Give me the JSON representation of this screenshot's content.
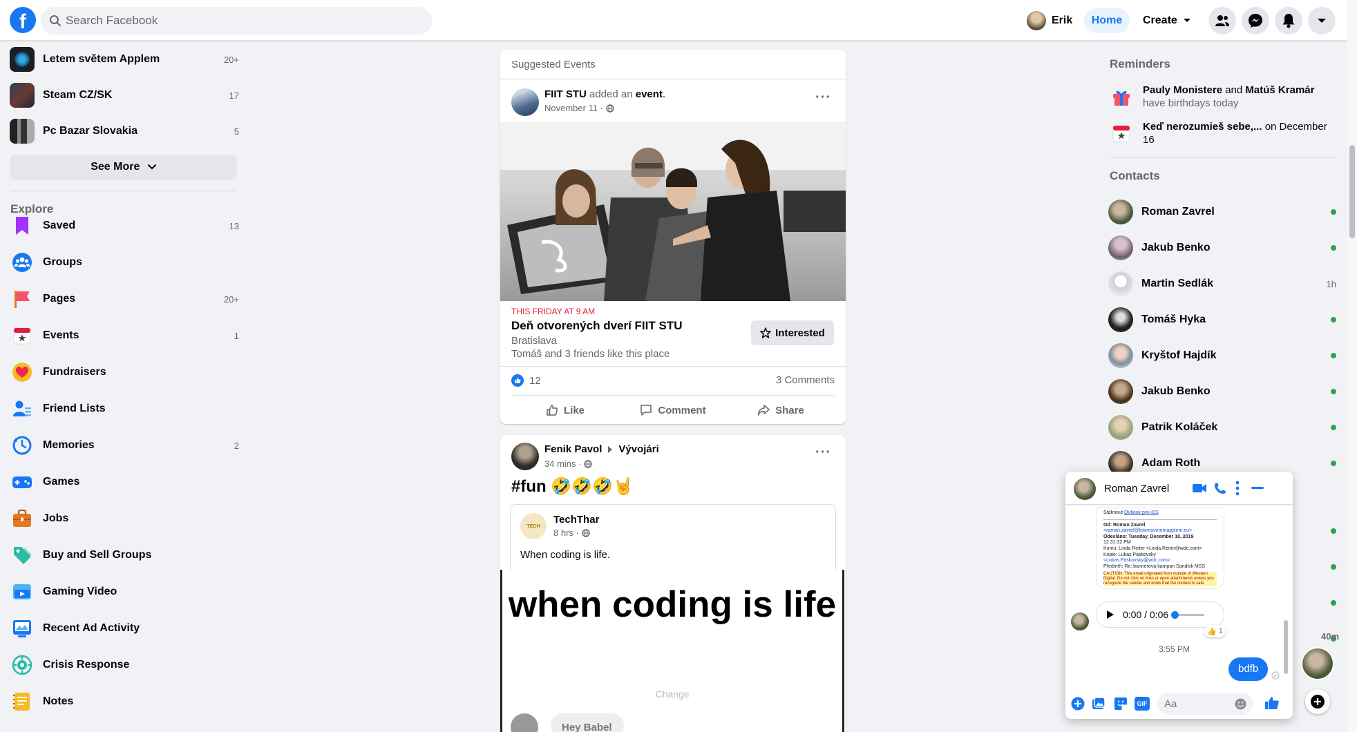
{
  "header": {
    "logo": "f",
    "search_placeholder": "Search Facebook",
    "profile_name": "Erik",
    "home_label": "Home",
    "create_label": "Create",
    "icons": [
      "people-icon",
      "messenger-icon",
      "bell-icon",
      "caret-down-icon"
    ]
  },
  "sidebar": {
    "groups": [
      {
        "name": "Letem světem Applem",
        "count": "20+"
      },
      {
        "name": "Steam CZ/SK",
        "count": "17"
      },
      {
        "name": "Pc Bazar Slovakia",
        "count": "5"
      }
    ],
    "see_more": "See More",
    "explore_title": "Explore",
    "explore": [
      {
        "label": "Saved",
        "count": "13",
        "icon": "bookmark-icon",
        "color": "#a033ff"
      },
      {
        "label": "Groups",
        "count": "",
        "icon": "groups-icon",
        "color": "#1877f2"
      },
      {
        "label": "Pages",
        "count": "20+",
        "icon": "flag-icon",
        "color": "#f35369"
      },
      {
        "label": "Events",
        "count": "1",
        "icon": "calendar-icon",
        "color": "#e41e3f"
      },
      {
        "label": "Fundraisers",
        "count": "",
        "icon": "heart-icon",
        "color": "#f7b928"
      },
      {
        "label": "Friend Lists",
        "count": "",
        "icon": "friend-list-icon",
        "color": "#1877f2"
      },
      {
        "label": "Memories",
        "count": "2",
        "icon": "clock-icon",
        "color": "#1877f2"
      },
      {
        "label": "Games",
        "count": "",
        "icon": "gamepad-icon",
        "color": "#1877f2"
      },
      {
        "label": "Jobs",
        "count": "",
        "icon": "briefcase-icon",
        "color": "#e77623"
      },
      {
        "label": "Buy and Sell Groups",
        "count": "",
        "icon": "tag-icon",
        "color": "#2abba7"
      },
      {
        "label": "Gaming Video",
        "count": "",
        "icon": "video-icon",
        "color": "#1877f2"
      },
      {
        "label": "Recent Ad Activity",
        "count": "",
        "icon": "ad-icon",
        "color": "#1877f2"
      },
      {
        "label": "Crisis Response",
        "count": "",
        "icon": "crisis-icon",
        "color": "#2abba7"
      },
      {
        "label": "Notes",
        "count": "",
        "icon": "notes-icon",
        "color": "#f7b928"
      }
    ]
  },
  "feed": {
    "suggested_title": "Suggested Events",
    "event_post": {
      "author": "FIIT STU",
      "action_pre": "added an",
      "action_obj": "event",
      "action_post": ".",
      "date": "November 11 ·",
      "event_time": "THIS FRIDAY AT 9 AM",
      "event_name": "Deň otvorených dverí FIIT STU",
      "location": "Bratislava",
      "friends": "Tomáš and 3 friends like this place",
      "interested": "Interested",
      "likes": "12",
      "comments": "3 Comments",
      "like": "Like",
      "comment": "Comment",
      "share": "Share"
    },
    "post2": {
      "author": "Fenik Pavol",
      "group": "Vývojári",
      "time": "34 mins ·",
      "text": "#fun 🤣🤣🤣🤘",
      "shared_author": "TechThar",
      "shared_time": "8 hrs ·",
      "shared_text": "When coding is life.",
      "meme_text": "when coding is life",
      "meme_sub": "Change",
      "meme_bubble": "Hey Babel"
    }
  },
  "right": {
    "reminders_title": "Reminders",
    "birthday_name1": "Pauly Monistere",
    "birthday_and": "and",
    "birthday_name2": "Matúš Kramár",
    "birthday_suffix": "have birthdays today",
    "event_reminder_name": "Keď nerozumieš sebe,...",
    "event_reminder_suffix": "on December 16",
    "contacts_title": "Contacts",
    "contacts": [
      {
        "name": "Roman Zavrel",
        "status": "online"
      },
      {
        "name": "Jakub Benko",
        "status": "online"
      },
      {
        "name": "Martin Sedlák",
        "status": "1h"
      },
      {
        "name": "Tomáš Hyka",
        "status": "online"
      },
      {
        "name": "Kryštof Hajdík",
        "status": "online"
      },
      {
        "name": "Jakub Benko",
        "status": "online"
      },
      {
        "name": "Patrik Koláček",
        "status": "online"
      },
      {
        "name": "Adam Roth",
        "status": "online"
      }
    ],
    "bubble_time": "40m"
  },
  "chat": {
    "name": "Roman Zavrel",
    "outlook_line_pre": "Stáhnout",
    "outlook_link": "Outlook pro iOS",
    "email_lines": [
      "Od: Roman Zavrel",
      "<roman.zavrel@letemsvetemapplem.eu>",
      "Odesláno: Tuesday, December 10, 2019",
      "12:31:32 PM",
      "Komu: Linda Reiter <Linda.Reiter@wdc.com>",
      "Kopie: Lukas Paskovsky",
      "<Lukas.Paskovsky@wdc.com>",
      "Předmět: Re: bannerova kampan Sandisk MSS"
    ],
    "caution": "CAUTION: This email originated from outside of Western Digital. Do not click on links or open attachments unless you recognize the sender and know that the content is safe",
    "audio_time": "0:00 / 0:06",
    "reaction_count": "1",
    "timestamp": "3:55 PM",
    "my_message": "bdfb",
    "input_placeholder": "Aa"
  }
}
